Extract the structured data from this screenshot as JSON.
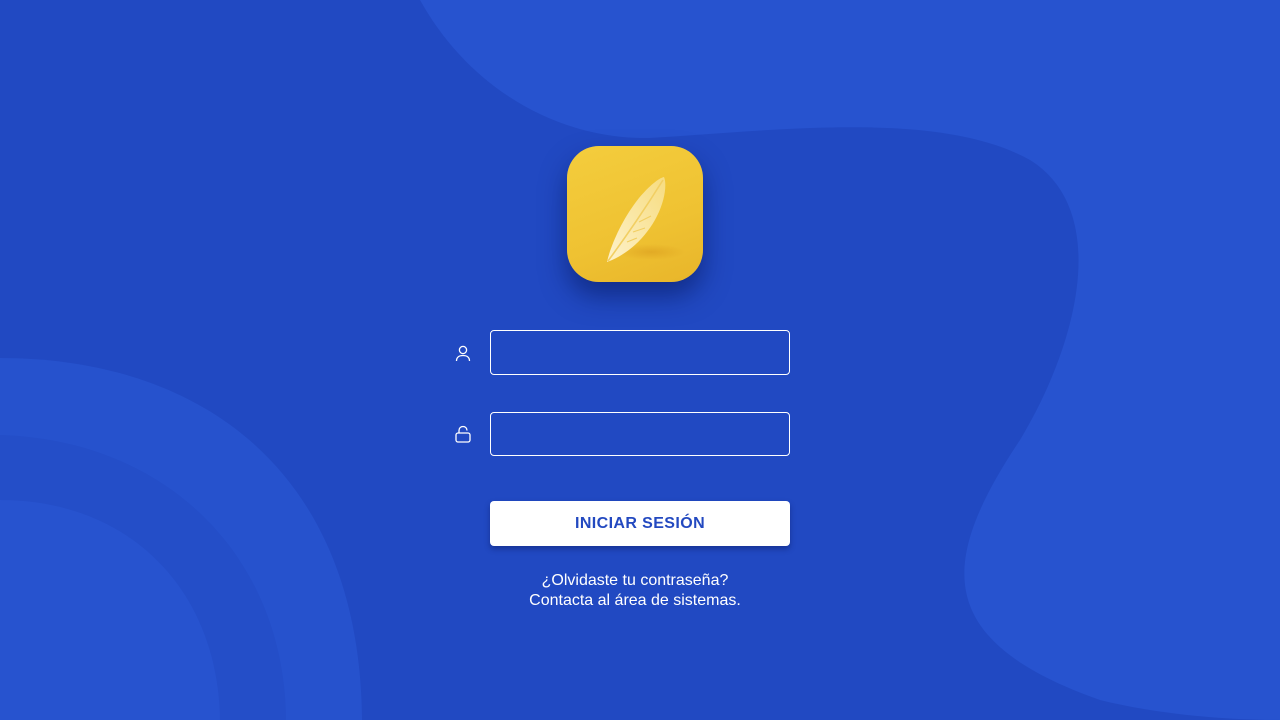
{
  "app": {
    "logo_icon": "feather-icon",
    "logo_color": "#f1c535",
    "background_color": "#2149c2",
    "accent_color": "#2349c0"
  },
  "login_form": {
    "username": {
      "icon": "user-icon",
      "value": "",
      "placeholder": ""
    },
    "password": {
      "icon": "lock-icon",
      "value": "",
      "placeholder": ""
    },
    "submit_label": "INICIAR SESIÓN"
  },
  "help": {
    "forgot_line": "¿Olvidaste tu contraseña?",
    "contact_line": "Contacta al área de sistemas."
  }
}
